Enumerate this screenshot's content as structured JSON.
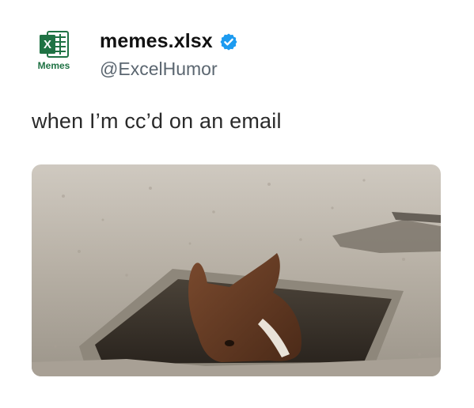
{
  "account": {
    "display_name": "memes.xlsx",
    "handle": "@ExcelHumor",
    "avatar_caption": "Memes",
    "avatar_logo_letter": "X",
    "verified": true
  },
  "post": {
    "text": "when I’m cc’d on an email",
    "image": {
      "icon": "horse-peeking-from-manhole-photo"
    }
  },
  "colors": {
    "excel_green": "#1f7244",
    "verified_blue": "#1d9bf0",
    "handle_gray": "#5b6670"
  }
}
